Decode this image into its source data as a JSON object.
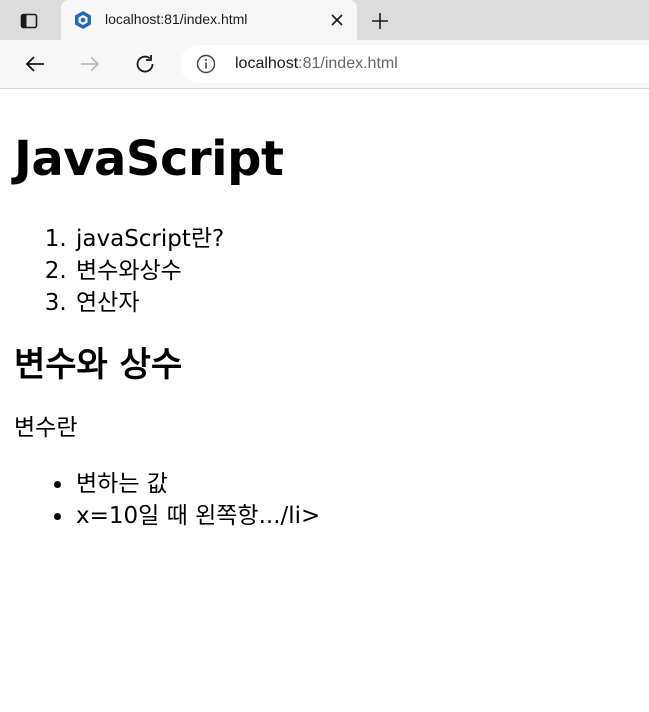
{
  "browser": {
    "tab_title": "localhost:81/index.html",
    "address": {
      "host": "localhost",
      "rest": ":81/index.html"
    }
  },
  "page": {
    "h1": "JavaScript",
    "toc": [
      "javaScript란?",
      "변수와상수",
      "연산자"
    ],
    "h2": "변수와 상수",
    "paragraph": "변수란",
    "bullets": [
      "변하는 값",
      "x=10일 때 왼쪽항.../li>"
    ]
  }
}
